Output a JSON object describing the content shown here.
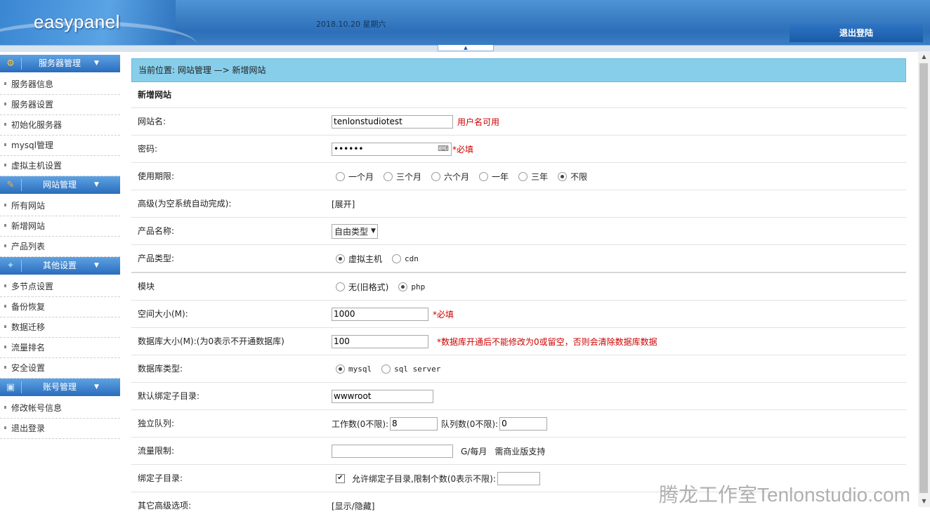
{
  "header": {
    "logo": "easypanel",
    "date": "2018.10.20 星期六",
    "logout_label": "退出登陆",
    "toggle_label": "▲"
  },
  "sidebar": {
    "sections": [
      {
        "title": "服务器管理",
        "icon": "server-icon",
        "items": [
          "服务器信息",
          "服务器设置",
          "初始化服务器",
          "mysql管理",
          "虚拟主机设置"
        ]
      },
      {
        "title": "网站管理",
        "icon": "website-icon",
        "items": [
          "所有网站",
          "新增网站",
          "产品列表"
        ]
      },
      {
        "title": "其他设置",
        "icon": "settings-icon",
        "items": [
          "多节点设置",
          "备份恢复",
          "数据迁移",
          "流量排名",
          "安全设置"
        ]
      },
      {
        "title": "账号管理",
        "icon": "account-icon",
        "items": [
          "修改帐号信息",
          "退出登录"
        ]
      }
    ],
    "arrow": "▼"
  },
  "breadcrumb": "当前位置: 网站管理 —> 新增网站",
  "form": {
    "title": "新增网站",
    "site_name": {
      "label": "网站名:",
      "value": "tenlonstudiotest",
      "hint": "用户名可用"
    },
    "password": {
      "label": "密码:",
      "value": "••••••",
      "hint": "*必填"
    },
    "period": {
      "label": "使用期限:",
      "options": [
        "一个月",
        "三个月",
        "六个月",
        "一年",
        "三年",
        "不限"
      ],
      "selected": "不限"
    },
    "advanced": {
      "label": "高级(为空系统自动完成):",
      "link": "[展开]"
    },
    "product_name": {
      "label": "产品名称:",
      "selected": "自由类型"
    },
    "product_type": {
      "label": "产品类型:",
      "options": [
        "虚拟主机",
        "cdn"
      ],
      "selected": "虚拟主机"
    },
    "module": {
      "label": "模块",
      "options": [
        "无(旧格式)",
        "php"
      ],
      "selected": "php"
    },
    "space": {
      "label": "空间大小(M):",
      "value": "1000",
      "hint": "*必填"
    },
    "db_size": {
      "label": "数据库大小(M):(为0表示不开通数据库)",
      "value": "100",
      "hint": "*数据库开通后不能修改为0或留空，否则会清除数据库数据"
    },
    "db_type": {
      "label": "数据库类型:",
      "options": [
        "mysql",
        "sql server"
      ],
      "selected": "mysql"
    },
    "subdir": {
      "label": "默认绑定子目录:",
      "value": "wwwroot"
    },
    "queue": {
      "label": "独立队列:",
      "workers_label": "工作数(0不限):",
      "workers_value": "8",
      "queue_label": "队列数(0不限):",
      "queue_value": "0"
    },
    "traffic": {
      "label": "流量限制:",
      "value": "",
      "unit": "G/每月",
      "note": "需商业版支持"
    },
    "bind_subdir": {
      "label": "绑定子目录:",
      "checked": true,
      "text": "允许绑定子目录,限制个数(0表示不限):",
      "value": ""
    },
    "other": {
      "label": "其它高级选项:",
      "link": "[显示/隐藏]"
    }
  },
  "watermark": "腾龙工作室Tenlonstudio.com"
}
